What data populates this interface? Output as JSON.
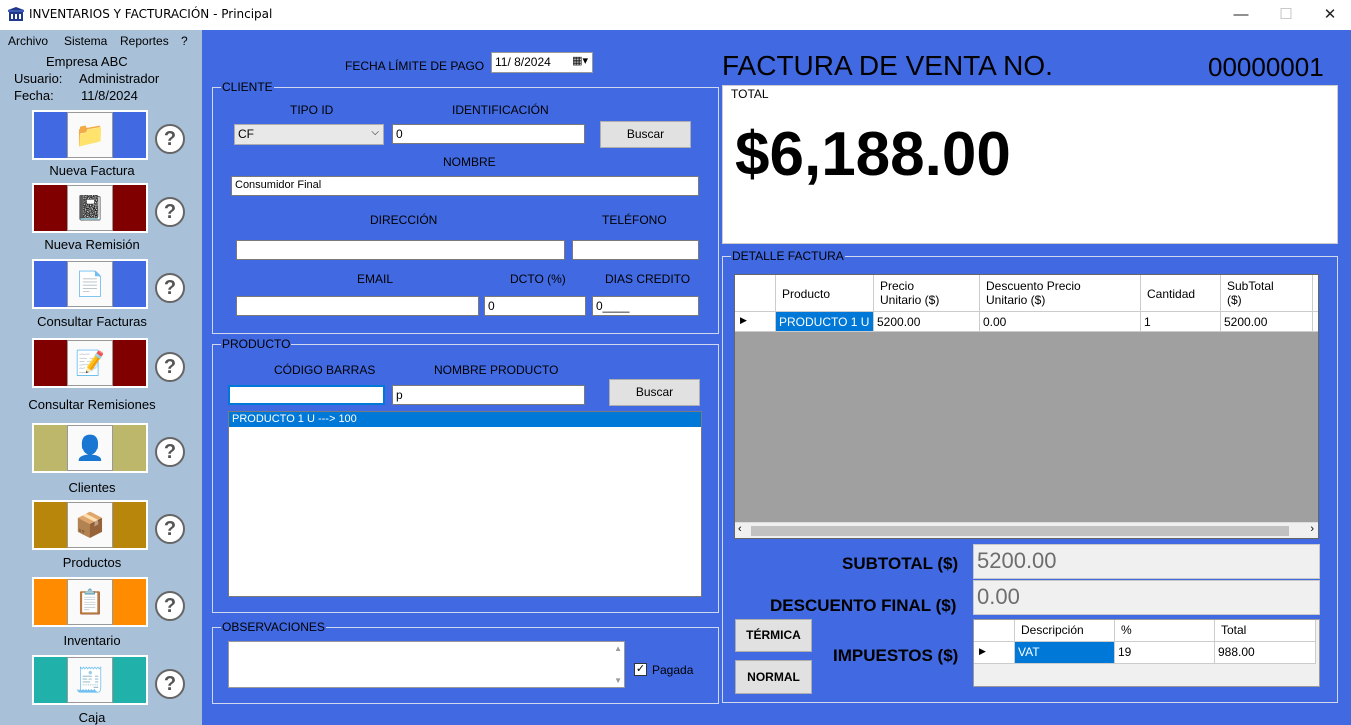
{
  "window": {
    "title": "INVENTARIOS Y FACTURACIÓN - Principal",
    "minimize": "—",
    "maximize": "☐",
    "close": "✕"
  },
  "menu": [
    "Archivo",
    "Sistema",
    "Reportes",
    "?"
  ],
  "sidebar": {
    "company": "Empresa ABC",
    "user_label": "Usuario:",
    "user": "Administrador",
    "date_label": "Fecha:",
    "date": "11/8/2024",
    "help": "?",
    "items": [
      {
        "label": "Nueva Factura",
        "icon": "invoice-icon",
        "bg": "#4169e1"
      },
      {
        "label": "Nueva Remisión",
        "icon": "notepad-icon",
        "bg": "#800000"
      },
      {
        "label": "Consultar Facturas",
        "icon": "document-list-icon",
        "bg": "#4169e1"
      },
      {
        "label": "Consultar Remisiones",
        "icon": "signed-document-icon",
        "bg": "#800000"
      },
      {
        "label": "Clientes",
        "icon": "client-folder-icon",
        "bg": "#bdb76b"
      },
      {
        "label": "Productos",
        "icon": "product-box-icon",
        "bg": "#b8860b"
      },
      {
        "label": "Inventario",
        "icon": "clipboard-icon",
        "bg": "#ff8c00"
      },
      {
        "label": "Caja",
        "icon": "cash-register-icon",
        "bg": "#20b2aa"
      }
    ]
  },
  "due_date": {
    "label": "FECHA LÍMITE DE PAGO",
    "value": "11/  8/2024"
  },
  "invoice": {
    "title": "FACTURA DE VENTA NO.",
    "number": "00000001"
  },
  "total": {
    "caption": "TOTAL",
    "value": "$6,188.00"
  },
  "client": {
    "caption": "CLIENTE",
    "tipo_id_label": "TIPO ID",
    "tipo_id": "CF",
    "ident_label": "IDENTIFICACIÓN",
    "ident": "0",
    "search": "Buscar",
    "name_label": "NOMBRE",
    "name": "Consumidor Final",
    "address_label": "DIRECCIÓN",
    "address": "",
    "phone_label": "TELÉFONO",
    "phone": "",
    "email_label": "EMAIL",
    "email": "",
    "dcto_label": "DCTO (%)",
    "dcto": "0",
    "credit_label": "DIAS CREDITO",
    "credit": "0____"
  },
  "product": {
    "caption": "PRODUCTO",
    "barcode_label": "CÓDIGO BARRAS",
    "barcode": "",
    "name_label": "NOMBRE PRODUCTO",
    "name": "p",
    "search": "Buscar",
    "results": [
      "PRODUCTO 1 U ---> 100"
    ]
  },
  "observations": {
    "caption": "OBSERVACIONES",
    "value": "",
    "paid_label": "Pagada",
    "paid": true
  },
  "detail": {
    "caption": "DETALLE FACTURA",
    "headers": [
      "Producto",
      "Precio\nUnitario ($)",
      "Descuento Precio\nUnitario ($)",
      "Cantidad",
      "SubTotal\n($)"
    ],
    "rows": [
      [
        "PRODUCTO 1 U",
        "5200.00",
        "0.00",
        "1",
        "5200.00"
      ]
    ]
  },
  "totals": {
    "subtotal_label": "SUBTOTAL ($)",
    "subtotal": "5200.00",
    "discount_label": "DESCUENTO FINAL ($)",
    "discount": "0.00",
    "taxes_label": "IMPUESTOS ($)"
  },
  "taxes": {
    "headers": [
      "Descripción",
      "%",
      "Total"
    ],
    "rows": [
      [
        "VAT",
        "19",
        "988.00"
      ]
    ]
  },
  "print": {
    "thermal": "TÉRMICA",
    "normal": "NORMAL"
  }
}
